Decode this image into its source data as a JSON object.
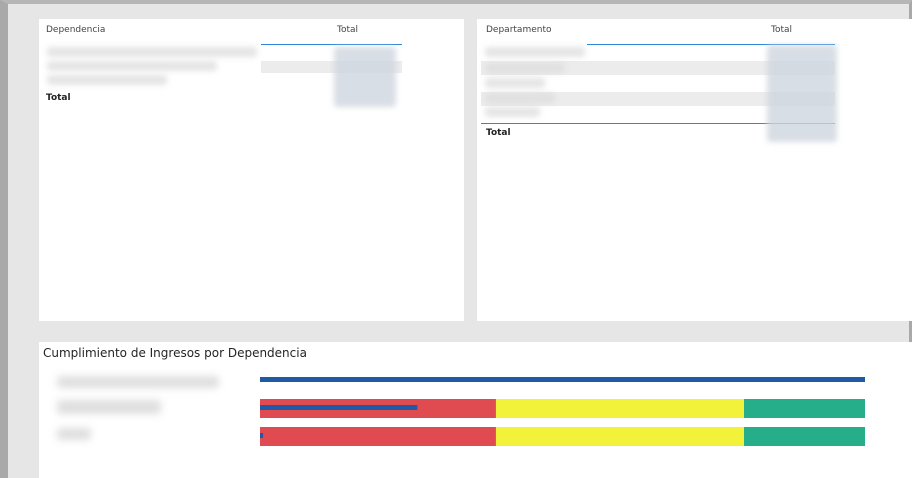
{
  "table_dependencia": {
    "col_name": "Dependencia",
    "col_total": "Total",
    "total_label": "Total"
  },
  "table_departamento": {
    "col_name": "Departamento",
    "col_total": "Total",
    "total_label": "Total"
  },
  "chart": {
    "title": "Cumplimiento de Ingresos por Dependencia",
    "colors": {
      "red": "#e04a51",
      "yellow": "#f2f23a",
      "green": "#26ae8a",
      "bar": "#1f5aa6"
    }
  },
  "chart_data": {
    "type": "bar",
    "rows": [
      {
        "bands": null,
        "value_fraction": 1.0
      },
      {
        "bands": [
          0.39,
          0.41,
          0.2
        ],
        "value_fraction": 0.26
      },
      {
        "bands": [
          0.39,
          0.41,
          0.2
        ],
        "value_fraction": 0.005
      }
    ]
  }
}
